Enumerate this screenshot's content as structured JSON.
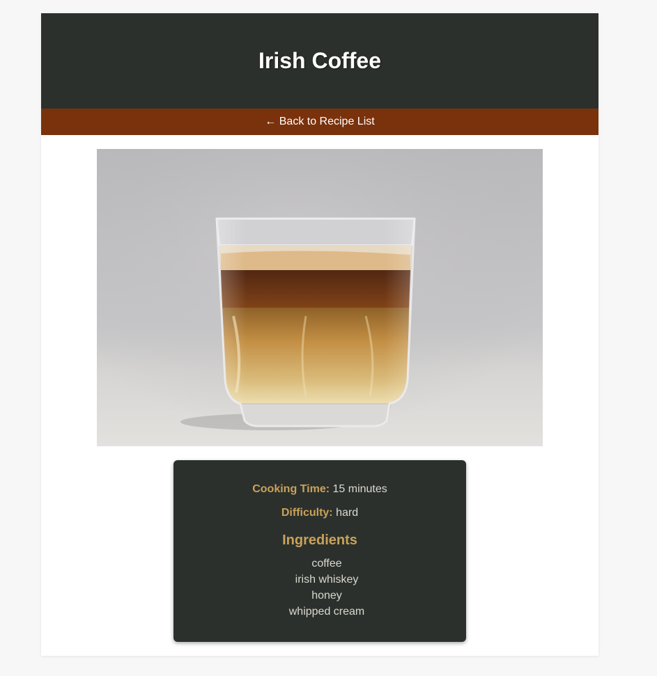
{
  "recipe": {
    "title": "Irish Coffee",
    "back_link": "← Back to Recipe List",
    "cooking_time_label": "Cooking Time:",
    "cooking_time_value": "15 minutes",
    "difficulty_label": "Difficulty:",
    "difficulty_value": "hard",
    "ingredients_heading": "Ingredients",
    "ingredients": [
      "coffee",
      "irish whiskey",
      "honey",
      "whipped cream"
    ]
  },
  "colors": {
    "header_bg": "#2c302c",
    "nav_bg": "#7a320c",
    "accent": "#c9a25b"
  }
}
